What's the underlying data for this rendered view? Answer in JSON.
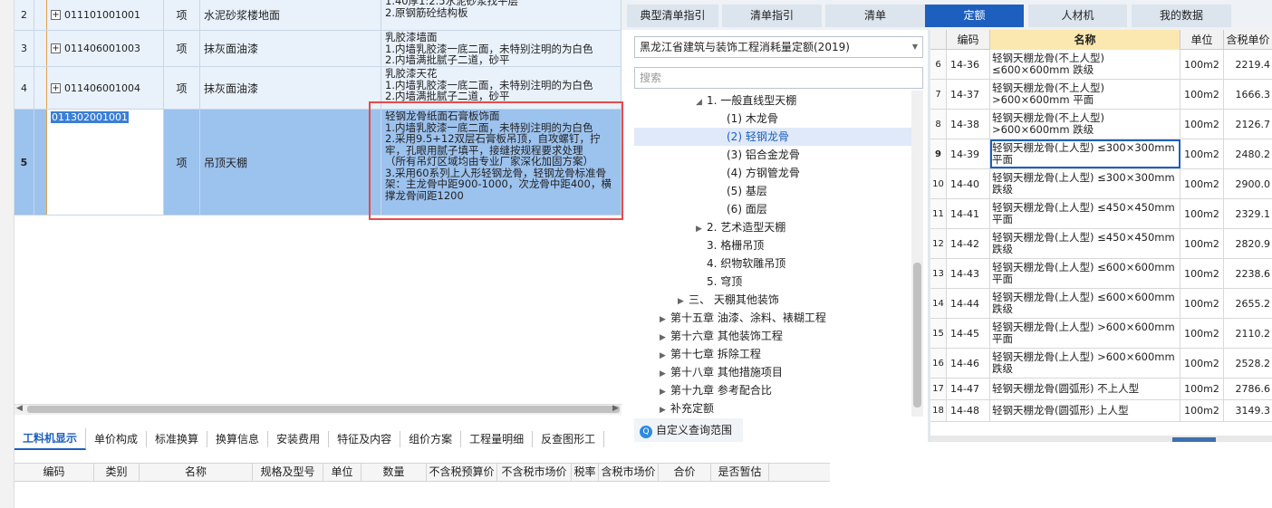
{
  "main_table": {
    "rows": [
      {
        "no": "2",
        "code": "011101001001",
        "unit": "项",
        "name": "水泥砂浆楼地面",
        "features": [
          "1.40厚1:2.5水泥砂浆找平层",
          "2.原钢筋砼结构板"
        ]
      },
      {
        "no": "3",
        "code": "011406001003",
        "unit": "项",
        "name": "抹灰面油漆",
        "features": [
          "乳胶漆墙面",
          "1.内墙乳胶漆一底二面，未特别注明的为白色",
          "2.内墙满批腻子二道，砂平"
        ]
      },
      {
        "no": "4",
        "code": "011406001004",
        "unit": "项",
        "name": "抹灰面油漆",
        "features": [
          "乳胶漆天花",
          "1.内墙乳胶漆一底二面，未特别注明的为白色",
          "2.内墙满批腻子二道，砂平"
        ]
      },
      {
        "no": "5",
        "code": "011302001001",
        "unit": "项",
        "name": "吊顶天棚",
        "features": [
          "轻钢龙骨纸面石膏板饰面",
          "1.内墙乳胶漆一底二面，未特别注明的为白色",
          "2.采用9.5+12双层石膏板吊顶，自攻螺钉，拧牢，孔眼用腻子填平，接缝按规程要求处理",
          "（所有吊灯区域均由专业厂家深化加固方案）",
          "3.采用60系列上人形轻钢龙骨，轻钢龙骨标准骨架：主龙骨中距900-1000，次龙骨中距400，横撑龙骨间距1200"
        ]
      }
    ]
  },
  "bottom_tabs": [
    "工料机显示",
    "单价构成",
    "标准换算",
    "换算信息",
    "安装费用",
    "特征及内容",
    "组价方案",
    "工程量明细",
    "反查图形工"
  ],
  "bottom_columns": [
    "编码",
    "类别",
    "名称",
    "规格及型号",
    "单位",
    "数量",
    "不含税预算价",
    "不含税市场价",
    "税率",
    "含税市场价",
    "合价",
    "是否暂估"
  ],
  "top_tabs": [
    "典型清单指引",
    "清单指引",
    "清单",
    "定额",
    "人材机",
    "我的数据"
  ],
  "active_tab": "定额",
  "quota_selector": {
    "value": "黑龙江省建筑与装饰工程消耗量定额(2019)",
    "search_placeholder": "搜索"
  },
  "tree": [
    {
      "label": "1. 一般直线型天棚",
      "level": 3,
      "state": "open"
    },
    {
      "label": "(1) 木龙骨",
      "level": 4,
      "state": "leaf"
    },
    {
      "label": "(2) 轻钢龙骨",
      "level": 4,
      "state": "leaf",
      "selected": true
    },
    {
      "label": "(3) 铝合金龙骨",
      "level": 4,
      "state": "leaf"
    },
    {
      "label": "(4) 方钢管龙骨",
      "level": 4,
      "state": "leaf"
    },
    {
      "label": "(5) 基层",
      "level": 4,
      "state": "leaf"
    },
    {
      "label": "(6) 面层",
      "level": 4,
      "state": "leaf"
    },
    {
      "label": "2. 艺术造型天棚",
      "level": 3,
      "state": "closed"
    },
    {
      "label": "3. 格栅吊顶",
      "level": 3,
      "state": "leaf"
    },
    {
      "label": "4. 织物软雕吊顶",
      "level": 3,
      "state": "leaf"
    },
    {
      "label": "5. 穹顶",
      "level": 3,
      "state": "leaf"
    },
    {
      "label": "三、 天棚其他装饰",
      "level": 2,
      "state": "closed"
    },
    {
      "label": "第十五章 油漆、涂料、裱糊工程",
      "level": 1,
      "state": "closed"
    },
    {
      "label": "第十六章 其他装饰工程",
      "level": 1,
      "state": "closed"
    },
    {
      "label": "第十七章 拆除工程",
      "level": 1,
      "state": "closed"
    },
    {
      "label": "第十八章 其他措施项目",
      "level": 1,
      "state": "closed"
    },
    {
      "label": "第十九章 参考配合比",
      "level": 1,
      "state": "closed"
    },
    {
      "label": "补充定额",
      "level": 1,
      "state": "closed"
    }
  ],
  "custom_scope_label": "自定义查询范围",
  "quota_table": {
    "columns": [
      "编码",
      "名称",
      "单位",
      "含税单价"
    ],
    "rows": [
      {
        "n": "6",
        "code": "14-36",
        "name": "轻钢天棚龙骨(不上人型) ≤600×600mm 跌级",
        "unit": "100m2",
        "price": "2219.4"
      },
      {
        "n": "7",
        "code": "14-37",
        "name": "轻钢天棚龙骨(不上人型) >600×600mm 平面",
        "unit": "100m2",
        "price": "1666.3"
      },
      {
        "n": "8",
        "code": "14-38",
        "name": "轻钢天棚龙骨(不上人型) >600×600mm 跌级",
        "unit": "100m2",
        "price": "2126.7"
      },
      {
        "n": "9",
        "code": "14-39",
        "name": "轻钢天棚龙骨(上人型) ≤300×300mm 平面",
        "unit": "100m2",
        "price": "2480.2",
        "selected": true
      },
      {
        "n": "10",
        "code": "14-40",
        "name": "轻钢天棚龙骨(上人型) ≤300×300mm 跌级",
        "unit": "100m2",
        "price": "2900.0"
      },
      {
        "n": "11",
        "code": "14-41",
        "name": "轻钢天棚龙骨(上人型) ≤450×450mm 平面",
        "unit": "100m2",
        "price": "2329.1"
      },
      {
        "n": "12",
        "code": "14-42",
        "name": "轻钢天棚龙骨(上人型) ≤450×450mm 跌级",
        "unit": "100m2",
        "price": "2820.9"
      },
      {
        "n": "13",
        "code": "14-43",
        "name": "轻钢天棚龙骨(上人型) ≤600×600mm 平面",
        "unit": "100m2",
        "price": "2238.6"
      },
      {
        "n": "14",
        "code": "14-44",
        "name": "轻钢天棚龙骨(上人型) ≤600×600mm 跌级",
        "unit": "100m2",
        "price": "2655.2"
      },
      {
        "n": "15",
        "code": "14-45",
        "name": "轻钢天棚龙骨(上人型) >600×600mm 平面",
        "unit": "100m2",
        "price": "2110.2"
      },
      {
        "n": "16",
        "code": "14-46",
        "name": "轻钢天棚龙骨(上人型) >600×600mm 跌级",
        "unit": "100m2",
        "price": "2528.2"
      },
      {
        "n": "17",
        "code": "14-47",
        "name": "轻钢天棚龙骨(圆弧形) 不上人型",
        "unit": "100m2",
        "price": "2786.6"
      },
      {
        "n": "18",
        "code": "14-48",
        "name": "轻钢天棚龙骨(圆弧形) 上人型",
        "unit": "100m2",
        "price": "3149.3"
      }
    ]
  },
  "colors": {
    "accent": "#1d5fbf",
    "selected_row": "#9cc2ee",
    "highlight_border": "#e84b4b",
    "name_header": "#fbe8b0"
  }
}
